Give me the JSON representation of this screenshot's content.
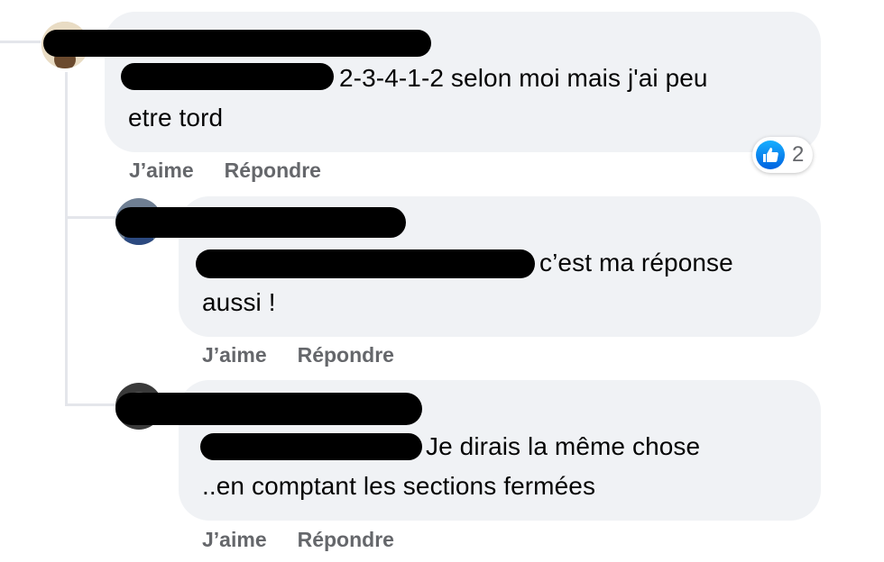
{
  "comments": [
    {
      "text_first": "2-3-4-1-2 selon moi mais j'ai peu",
      "text_second": "etre tord",
      "like_label": "J’aime",
      "reply_label": "Répondre",
      "reaction_count": "2",
      "reaction_icon": "thumbs-up-icon"
    },
    {
      "text_first": "c’est ma réponse",
      "text_second": "aussi !",
      "like_label": "J’aime",
      "reply_label": "Répondre"
    },
    {
      "text_first": "Je dirais la même chose",
      "text_second": "..en comptant les sections fermées",
      "like_label": "J’aime",
      "reply_label": "Répondre"
    }
  ],
  "colors": {
    "bubble": "#f0f2f5",
    "action_text": "#65676b",
    "like_blue": "#0866ff",
    "thread_line": "#e4e6eb"
  }
}
